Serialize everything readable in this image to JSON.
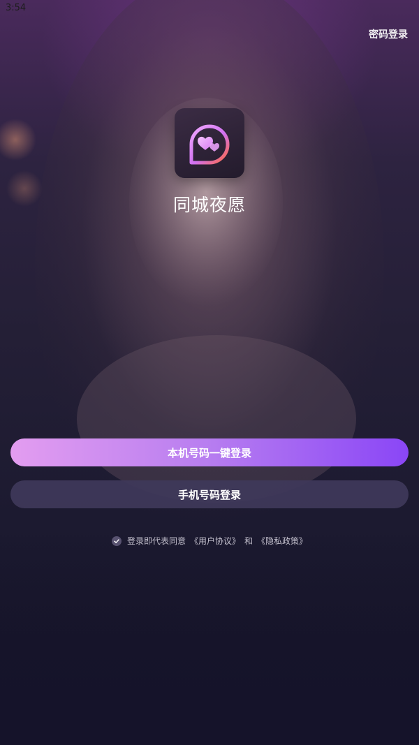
{
  "status_bar": {
    "time": "3:54"
  },
  "header": {
    "password_login": "密码登录"
  },
  "app": {
    "name": "同城夜愿"
  },
  "buttons": {
    "one_click_login": "本机号码一键登录",
    "phone_login": "手机号码登录"
  },
  "agreement": {
    "prefix": "登录即代表同意",
    "user_agreement": "《用户协议》",
    "and": "和",
    "privacy_policy": "《隐私政策》"
  },
  "colors": {
    "primary_gradient_start": "#e39df0",
    "primary_gradient_end": "#8a46f6",
    "secondary_button": "#3f385a",
    "icon_ring_start": "#f0a8ff",
    "icon_ring_end": "#ff6a3d"
  }
}
